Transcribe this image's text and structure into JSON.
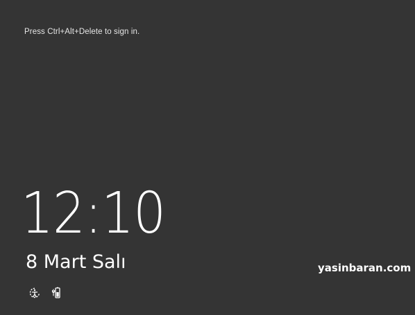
{
  "lock_screen": {
    "prompt": "Press Ctrl+Alt+Delete to sign in.",
    "time": "12:10",
    "date": "8 Mart Salı"
  },
  "watermark": {
    "text": "yasinbaran.com"
  },
  "taskbar_icons": [
    {
      "name": "ease-of-access-icon"
    },
    {
      "name": "battery-power-icon"
    }
  ],
  "colors": {
    "background": "#343434",
    "text": "#ffffff"
  }
}
